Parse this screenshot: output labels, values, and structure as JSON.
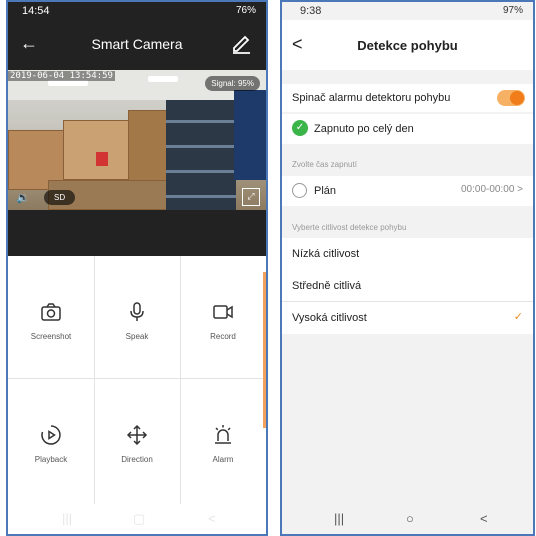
{
  "left": {
    "status": {
      "time": "14:54",
      "indicators": "    76%",
      "battery": "76%"
    },
    "header": {
      "back_icon": "←",
      "title": "Smart Camera",
      "edit_icon": "pencil-icon"
    },
    "video": {
      "timestamp": "2019-06-04 13:54:59",
      "signal": "Signal: 95%",
      "sound_icon": "🔉",
      "quality": "SD",
      "expand_icon": "⤢"
    },
    "controls": [
      {
        "label": "Screenshot",
        "icon": "camera-icon"
      },
      {
        "label": "Speak",
        "icon": "microphone-icon"
      },
      {
        "label": "Record",
        "icon": "video-camera-icon"
      },
      {
        "label": "Playback",
        "icon": "playback-icon"
      },
      {
        "label": "Direction",
        "icon": "move-arrows-icon"
      },
      {
        "label": "Alarm",
        "icon": "alarm-siren-icon"
      }
    ],
    "nav": {
      "recent": "|||",
      "home": "▢",
      "back": "<"
    }
  },
  "right": {
    "status": {
      "time": "9:38",
      "battery": "97%"
    },
    "header": {
      "back_icon": "<",
      "title": "Detekce pohybu"
    },
    "alarm_switch": {
      "label": "Spinač alarmu detektoru pohybu",
      "on": true
    },
    "all_day": {
      "label": "Zapnuto po celý den",
      "icon": "check-circle-icon"
    },
    "time_section": "Zvolte čas zapnutí",
    "plan": {
      "label": "Plán",
      "time": "00:00-00:00 >"
    },
    "sensitivity_section": "Vyberte citlivost detekce pohybu",
    "sensitivity": [
      {
        "label": "Nízká citlivost",
        "selected": false
      },
      {
        "label": "Středně citlivá",
        "selected": false
      },
      {
        "label": "Vysoká citlivost",
        "selected": true
      }
    ],
    "selected_mark": "✓",
    "nav": {
      "recent": "|||",
      "home": "○",
      "back": "<"
    }
  },
  "colors": {
    "accent_orange": "#f07c1a",
    "green": "#3bb54a",
    "frame_blue": "#4a78b8"
  }
}
